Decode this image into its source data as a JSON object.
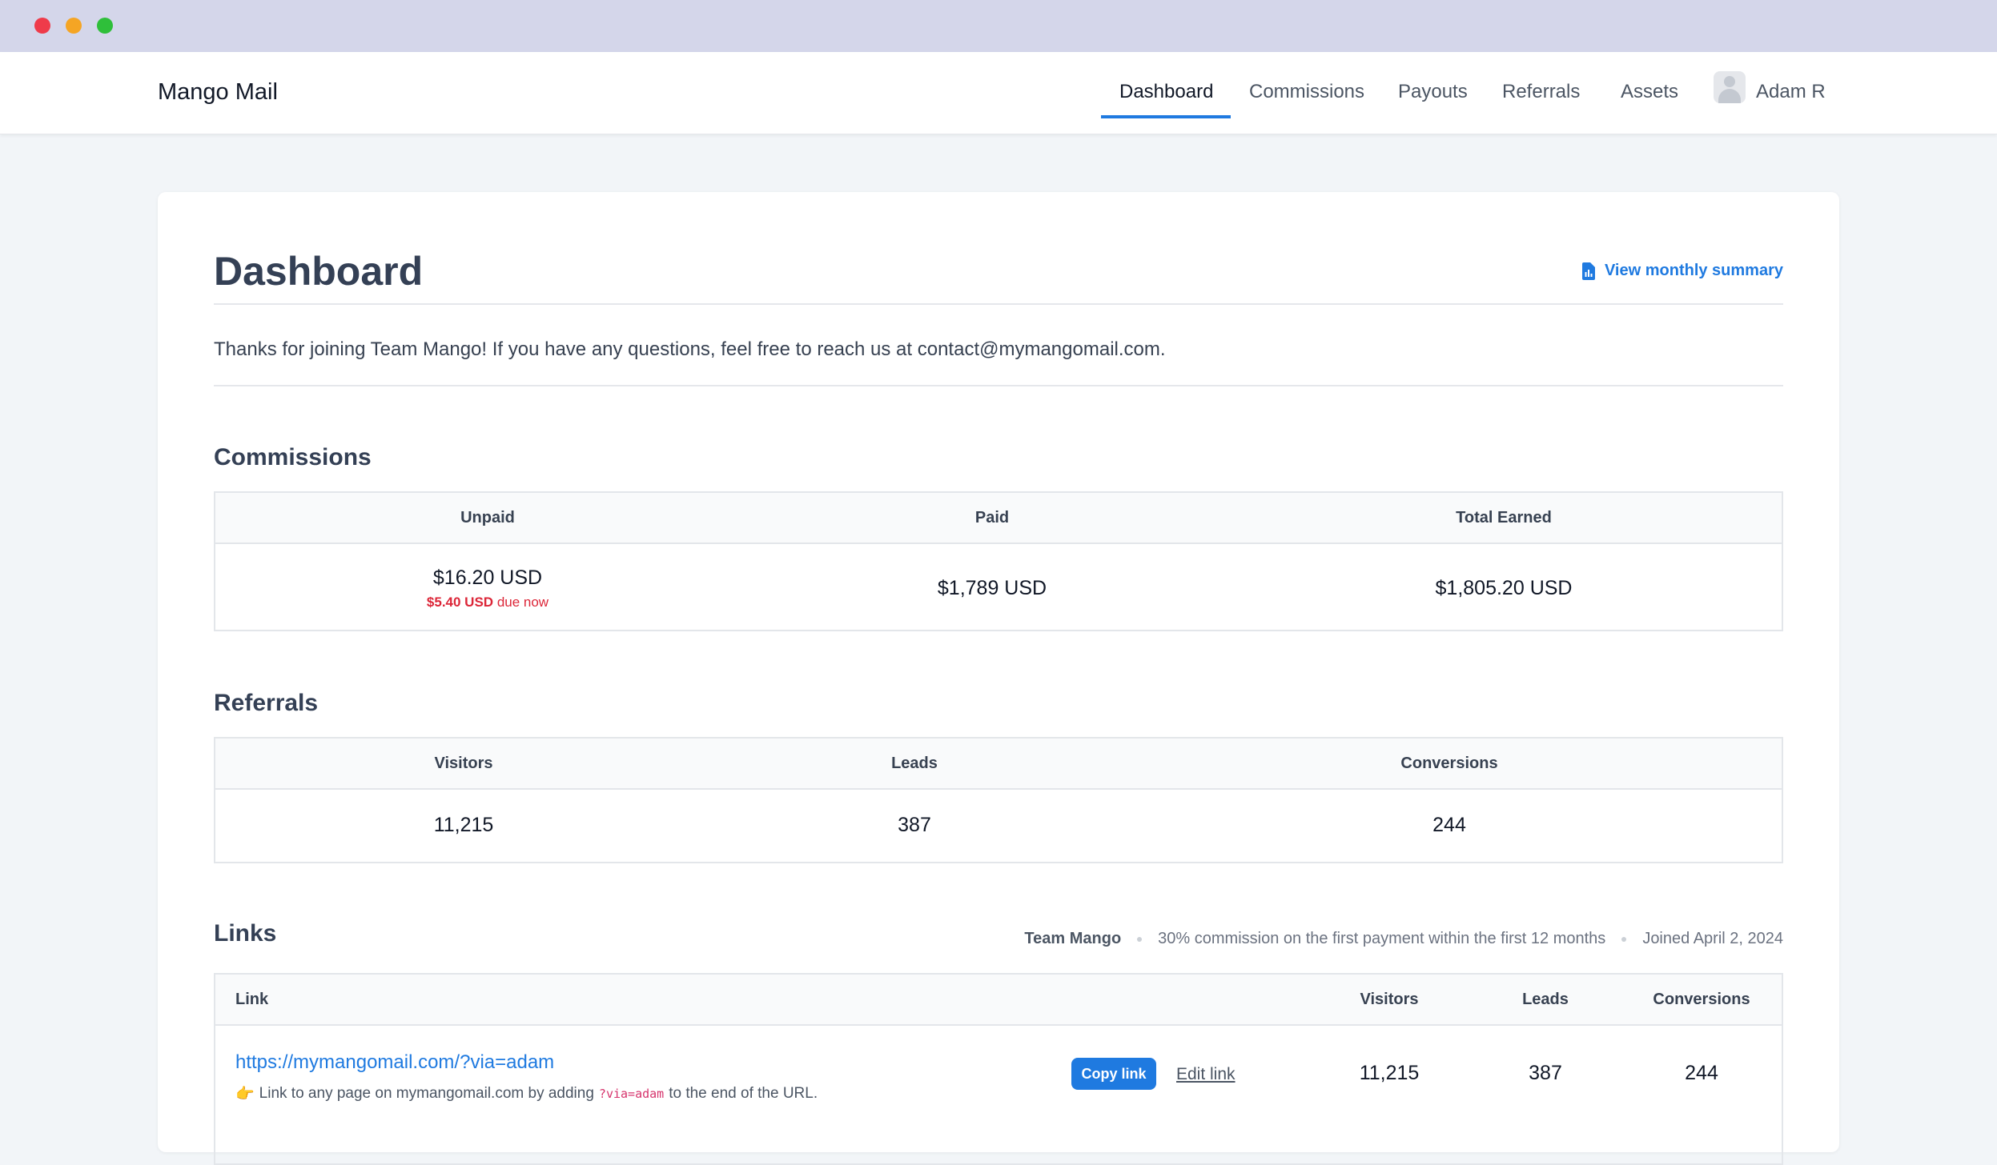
{
  "app": {
    "brand": "Mango Mail"
  },
  "nav": {
    "items": [
      {
        "label": "Dashboard",
        "active": true
      },
      {
        "label": "Commissions"
      },
      {
        "label": "Payouts"
      },
      {
        "label": "Referrals"
      },
      {
        "label": "Assets"
      }
    ],
    "user_name": "Adam R"
  },
  "page": {
    "title": "Dashboard",
    "summary_link": "View monthly summary",
    "intro": "Thanks for joining Team Mango! If you have any questions, feel free to reach us at contact@mymangomail.com."
  },
  "commissions": {
    "heading": "Commissions",
    "headers": [
      "Unpaid",
      "Paid",
      "Total Earned"
    ],
    "unpaid": "$16.20 USD",
    "due_amount": "$5.40 USD",
    "due_suffix": "due now",
    "paid": "$1,789 USD",
    "total": "$1,805.20 USD"
  },
  "referrals": {
    "heading": "Referrals",
    "headers": [
      "Visitors",
      "Leads",
      "Conversions"
    ],
    "values": [
      "11,215",
      "387",
      "244"
    ]
  },
  "links": {
    "heading": "Links",
    "meta": {
      "team": "Team Mango",
      "commission": "30% commission on the first payment within the first 12 months",
      "joined": "Joined April 2, 2024"
    },
    "headers": [
      "Link",
      "Visitors",
      "Leads",
      "Conversions"
    ],
    "rows": [
      {
        "url": "https://mymangomail.com/?via=adam",
        "hint_prefix": "Link to any page on mymangomail.com by adding",
        "hint_code": "?via=adam",
        "hint_suffix": "to the end of the URL.",
        "copy_label": "Copy link",
        "edit_label": "Edit link",
        "visitors": "11,215",
        "leads": "387",
        "conversions": "244"
      }
    ]
  },
  "colors": {
    "accent": "#1f7ae0",
    "danger": "#dc2638",
    "heading": "#344055"
  },
  "icons": {
    "summary": "document-chart-icon",
    "hint": "pointing-hand-icon",
    "avatar": "user-avatar-icon"
  }
}
